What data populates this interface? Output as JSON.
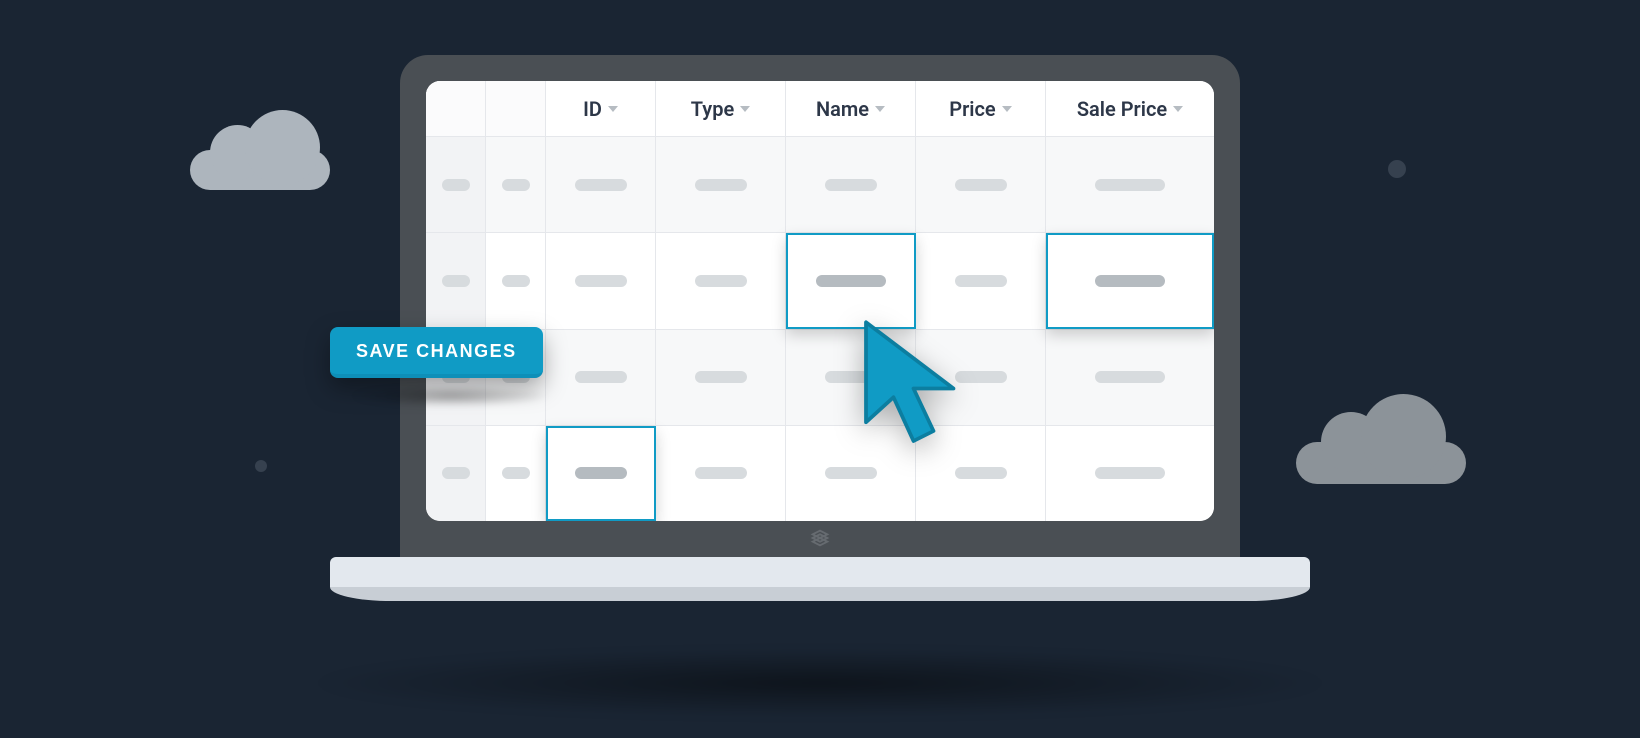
{
  "colors": {
    "background": "#1a2533",
    "accent": "#109bc5",
    "accent_border": "#0e8fb8",
    "laptop_frame": "#4a4f54",
    "placeholder": "#d7dbde"
  },
  "save_button": {
    "label": "SAVE CHANGES"
  },
  "table": {
    "columns": [
      {
        "key": "blank_a",
        "label": "",
        "sortable": false
      },
      {
        "key": "blank_b",
        "label": "",
        "sortable": false
      },
      {
        "key": "id",
        "label": "ID",
        "sortable": true
      },
      {
        "key": "type",
        "label": "Type",
        "sortable": true
      },
      {
        "key": "name",
        "label": "Name",
        "sortable": true
      },
      {
        "key": "price",
        "label": "Price",
        "sortable": true
      },
      {
        "key": "sale_price",
        "label": "Sale Price",
        "sortable": true
      }
    ],
    "rows": [
      {
        "alt": true,
        "selected_cells": []
      },
      {
        "alt": false,
        "selected_cells": [
          "name",
          "sale_price"
        ]
      },
      {
        "alt": true,
        "selected_cells": []
      },
      {
        "alt": false,
        "selected_cells": [
          "id"
        ]
      }
    ]
  },
  "icons": {
    "sort_caret": "chevron-down-icon",
    "cursor": "cursor-icon",
    "logo": "brand-logo-icon"
  }
}
